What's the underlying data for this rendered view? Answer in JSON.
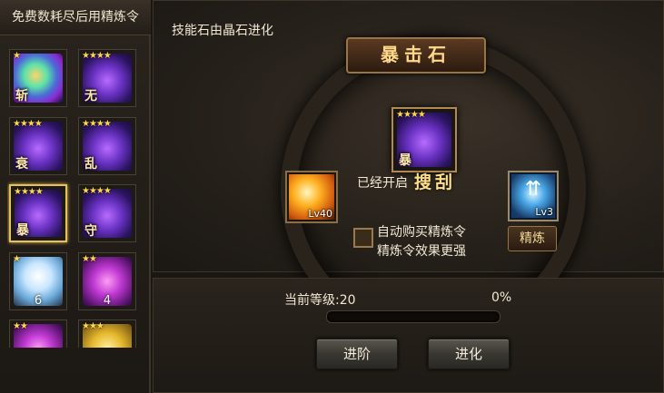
{
  "sidebar": {
    "title": "免费数耗尽后用精炼令",
    "items": [
      {
        "stars": "★",
        "glyph": "斩"
      },
      {
        "stars": "★★★★",
        "glyph": "无"
      },
      {
        "stars": "★★★★",
        "glyph": "衰"
      },
      {
        "stars": "★★★★",
        "glyph": "乱"
      },
      {
        "stars": "★★★★",
        "glyph": "暴"
      },
      {
        "stars": "★★★★",
        "glyph": "守"
      },
      {
        "stars": "★",
        "count": "6"
      },
      {
        "stars": "★★",
        "count": "4"
      },
      {
        "stars": "★★",
        "count": ""
      },
      {
        "stars": "★★★",
        "count": ""
      }
    ]
  },
  "main": {
    "hint": "技能石由晶石进化",
    "title": "暴击石",
    "center_stars": "★★★★",
    "center_glyph": "暴",
    "left_level": "Lv40",
    "right_level": "Lv3",
    "opened_text": "已经开启",
    "skill_name": "搜刮",
    "auto_buy": "自动购买精炼令",
    "auto_effect": "精炼令效果更强",
    "refine_label": "精炼"
  },
  "bottom": {
    "level_text": "当前等级:20",
    "progress_text": "0%",
    "progress": 0,
    "advance_label": "进阶",
    "evolve_label": "进化"
  },
  "colors": {
    "accent_gold": "#e7c25a",
    "title_gold": "#ffd98a"
  }
}
